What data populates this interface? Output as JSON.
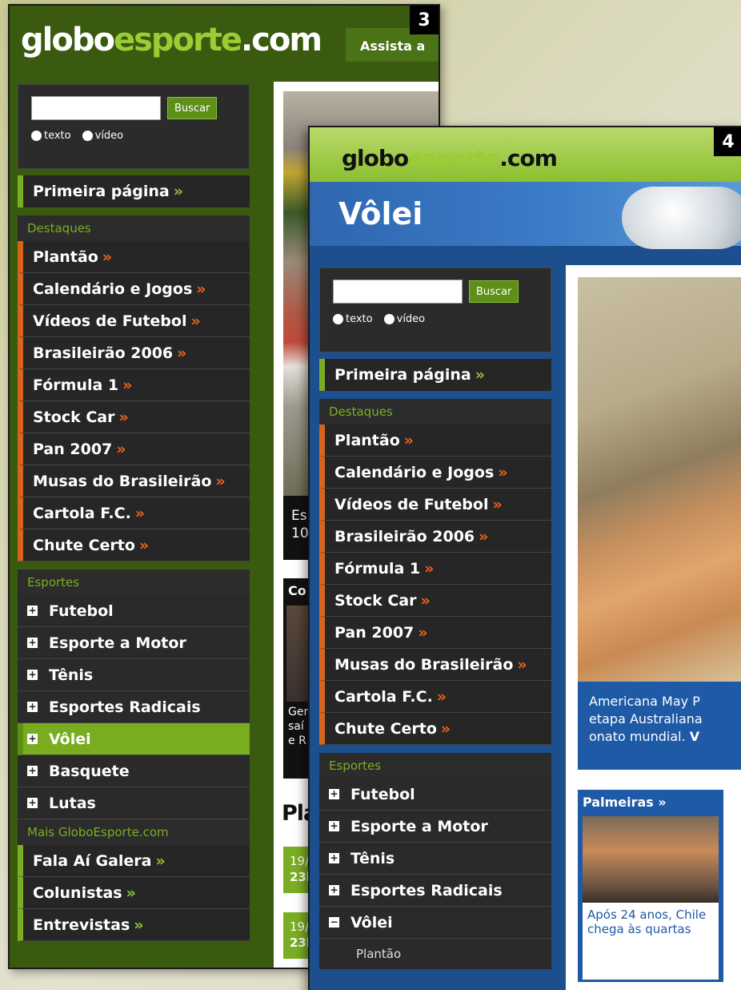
{
  "w3": {
    "badge": "3",
    "logo_a": "globo",
    "logo_b": "esporte",
    "logo_c": ".com",
    "assista": "Assista a",
    "search_btn": "Buscar",
    "radio_text": "texto",
    "radio_video": "vídeo",
    "primeira": "Primeira página",
    "destaques_head": "Destaques",
    "destaques": [
      "Plantão",
      "Calendário e Jogos",
      "Vídeos de Futebol",
      "Brasileirão 2006",
      "Fórmula 1",
      "Stock Car",
      "Pan 2007",
      "Musas do Brasileirão",
      "Cartola F.C.",
      "Chute Certo"
    ],
    "esportes_head": "Esportes",
    "esportes": [
      "Futebol",
      "Esporte a Motor",
      "Tênis",
      "Esportes Radicais",
      "Vôlei",
      "Basquete",
      "Lutas"
    ],
    "mais_head": "Mais GloboEsporte.com",
    "mais": [
      "Fala Aí Galera",
      "Colunistas",
      "Entrevistas"
    ],
    "cap_l1": "Es",
    "cap_l2": "10",
    "col_title": "Co",
    "col_l1": "Ger",
    "col_l2": "saí",
    "col_l3": "e R",
    "plan_title": "Pla",
    "plan1_l1": "19/",
    "plan1_l2": "23h",
    "plan2_l1": "19/",
    "plan2_l2": "23h"
  },
  "w4": {
    "badge": "4",
    "logo_a": "globo",
    "logo_b": "esporte",
    "logo_c": ".com",
    "section_title": "Vôlei",
    "search_btn": "Buscar",
    "radio_text": "texto",
    "radio_video": "vídeo",
    "primeira": "Primeira página",
    "destaques_head": "Destaques",
    "destaques": [
      "Plantão",
      "Calendário e Jogos",
      "Vídeos de Futebol",
      "Brasileirão 2006",
      "Fórmula 1",
      "Stock Car",
      "Pan 2007",
      "Musas do Brasileirão",
      "Cartola F.C.",
      "Chute Certo"
    ],
    "esportes_head": "Esportes",
    "esportes": [
      "Futebol",
      "Esporte a Motor",
      "Tênis",
      "Esportes Radicais",
      "Vôlei"
    ],
    "sub_item": "Plantão",
    "hero_cap_l1": "Americana May P",
    "hero_cap_l2": "etapa Australiana",
    "hero_cap_l3": "onato mundial.",
    "hero_cap_bold": "V",
    "news_title": "Palmeiras »",
    "news_text": "Após 24 anos, Chile chega às quartas"
  },
  "raquo": "»",
  "colors": {
    "green": "#7aae22",
    "orange": "#d7641a",
    "blue": "#1f5aa6"
  }
}
